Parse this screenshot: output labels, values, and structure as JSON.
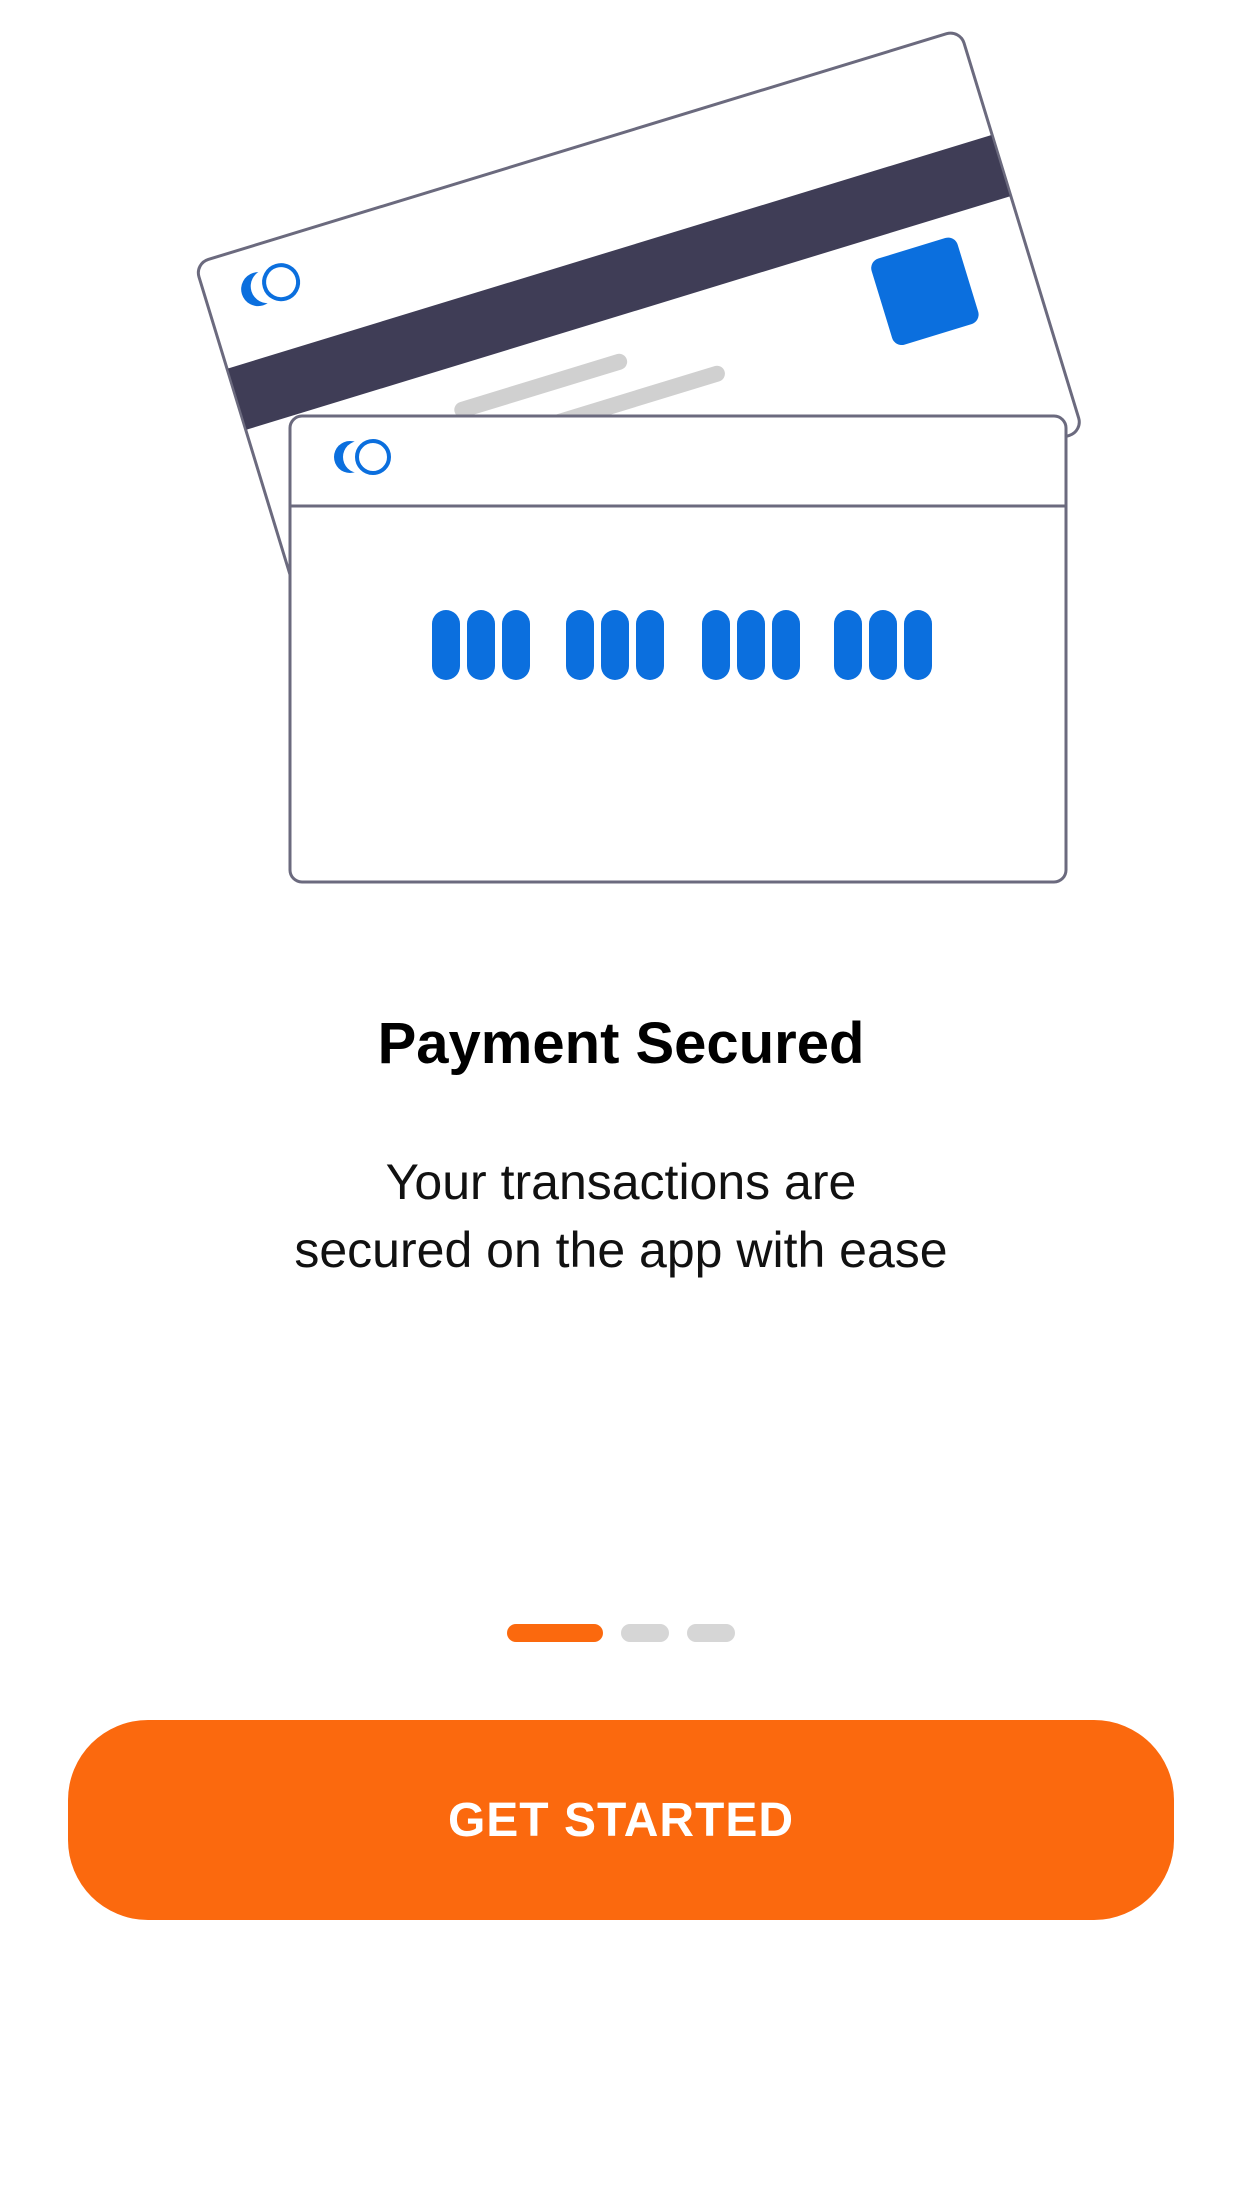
{
  "illustration": {
    "name": "payment-cards-illustration",
    "accent_color": "#0b6fde",
    "stripe_color": "#3f3d56",
    "outline_color": "#6b6a7e"
  },
  "onboarding": {
    "title": "Payment Secured",
    "subtitle_line1": "Your transactions are",
    "subtitle_line2": "secured on the app with ease"
  },
  "pager": {
    "active_color": "#fb690e",
    "inactive_color": "#d6d6d6",
    "current_page": 1,
    "total_pages": 3
  },
  "cta": {
    "label": "GET STARTED",
    "color": "#fb690e"
  }
}
